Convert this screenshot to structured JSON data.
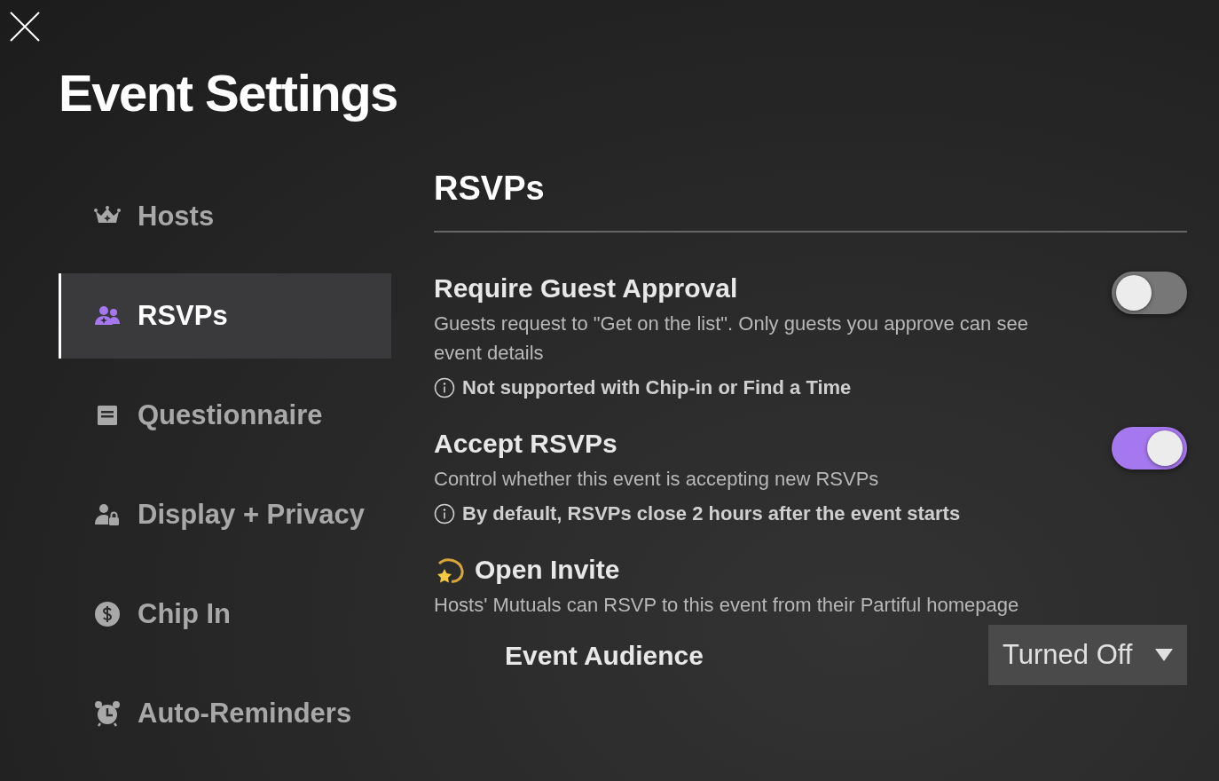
{
  "title": "Event Settings",
  "sidebar": {
    "items": [
      {
        "label": "Hosts",
        "selected": false
      },
      {
        "label": "RSVPs",
        "selected": true
      },
      {
        "label": "Questionnaire",
        "selected": false
      },
      {
        "label": "Display + Privacy",
        "selected": false
      },
      {
        "label": "Chip In",
        "selected": false
      },
      {
        "label": "Auto-Reminders",
        "selected": false
      }
    ]
  },
  "section": {
    "title": "RSVPs",
    "settings": [
      {
        "kind": "toggle",
        "title": "Require Guest Approval",
        "description": "Guests request to \"Get on the list\". Only guests you approve can see event details",
        "note": "Not supported with Chip-in or Find a Time",
        "on": false
      },
      {
        "kind": "toggle",
        "title": "Accept RSVPs",
        "description": "Control whether this event is accepting new RSVPs",
        "note": "By default, RSVPs close 2 hours after the event starts",
        "on": true
      },
      {
        "kind": "select",
        "title": "Open Invite",
        "description": "Hosts' Mutuals can RSVP to this event from their Partiful homepage",
        "field": {
          "label": "Event Audience",
          "value": "Turned Off"
        }
      }
    ]
  }
}
